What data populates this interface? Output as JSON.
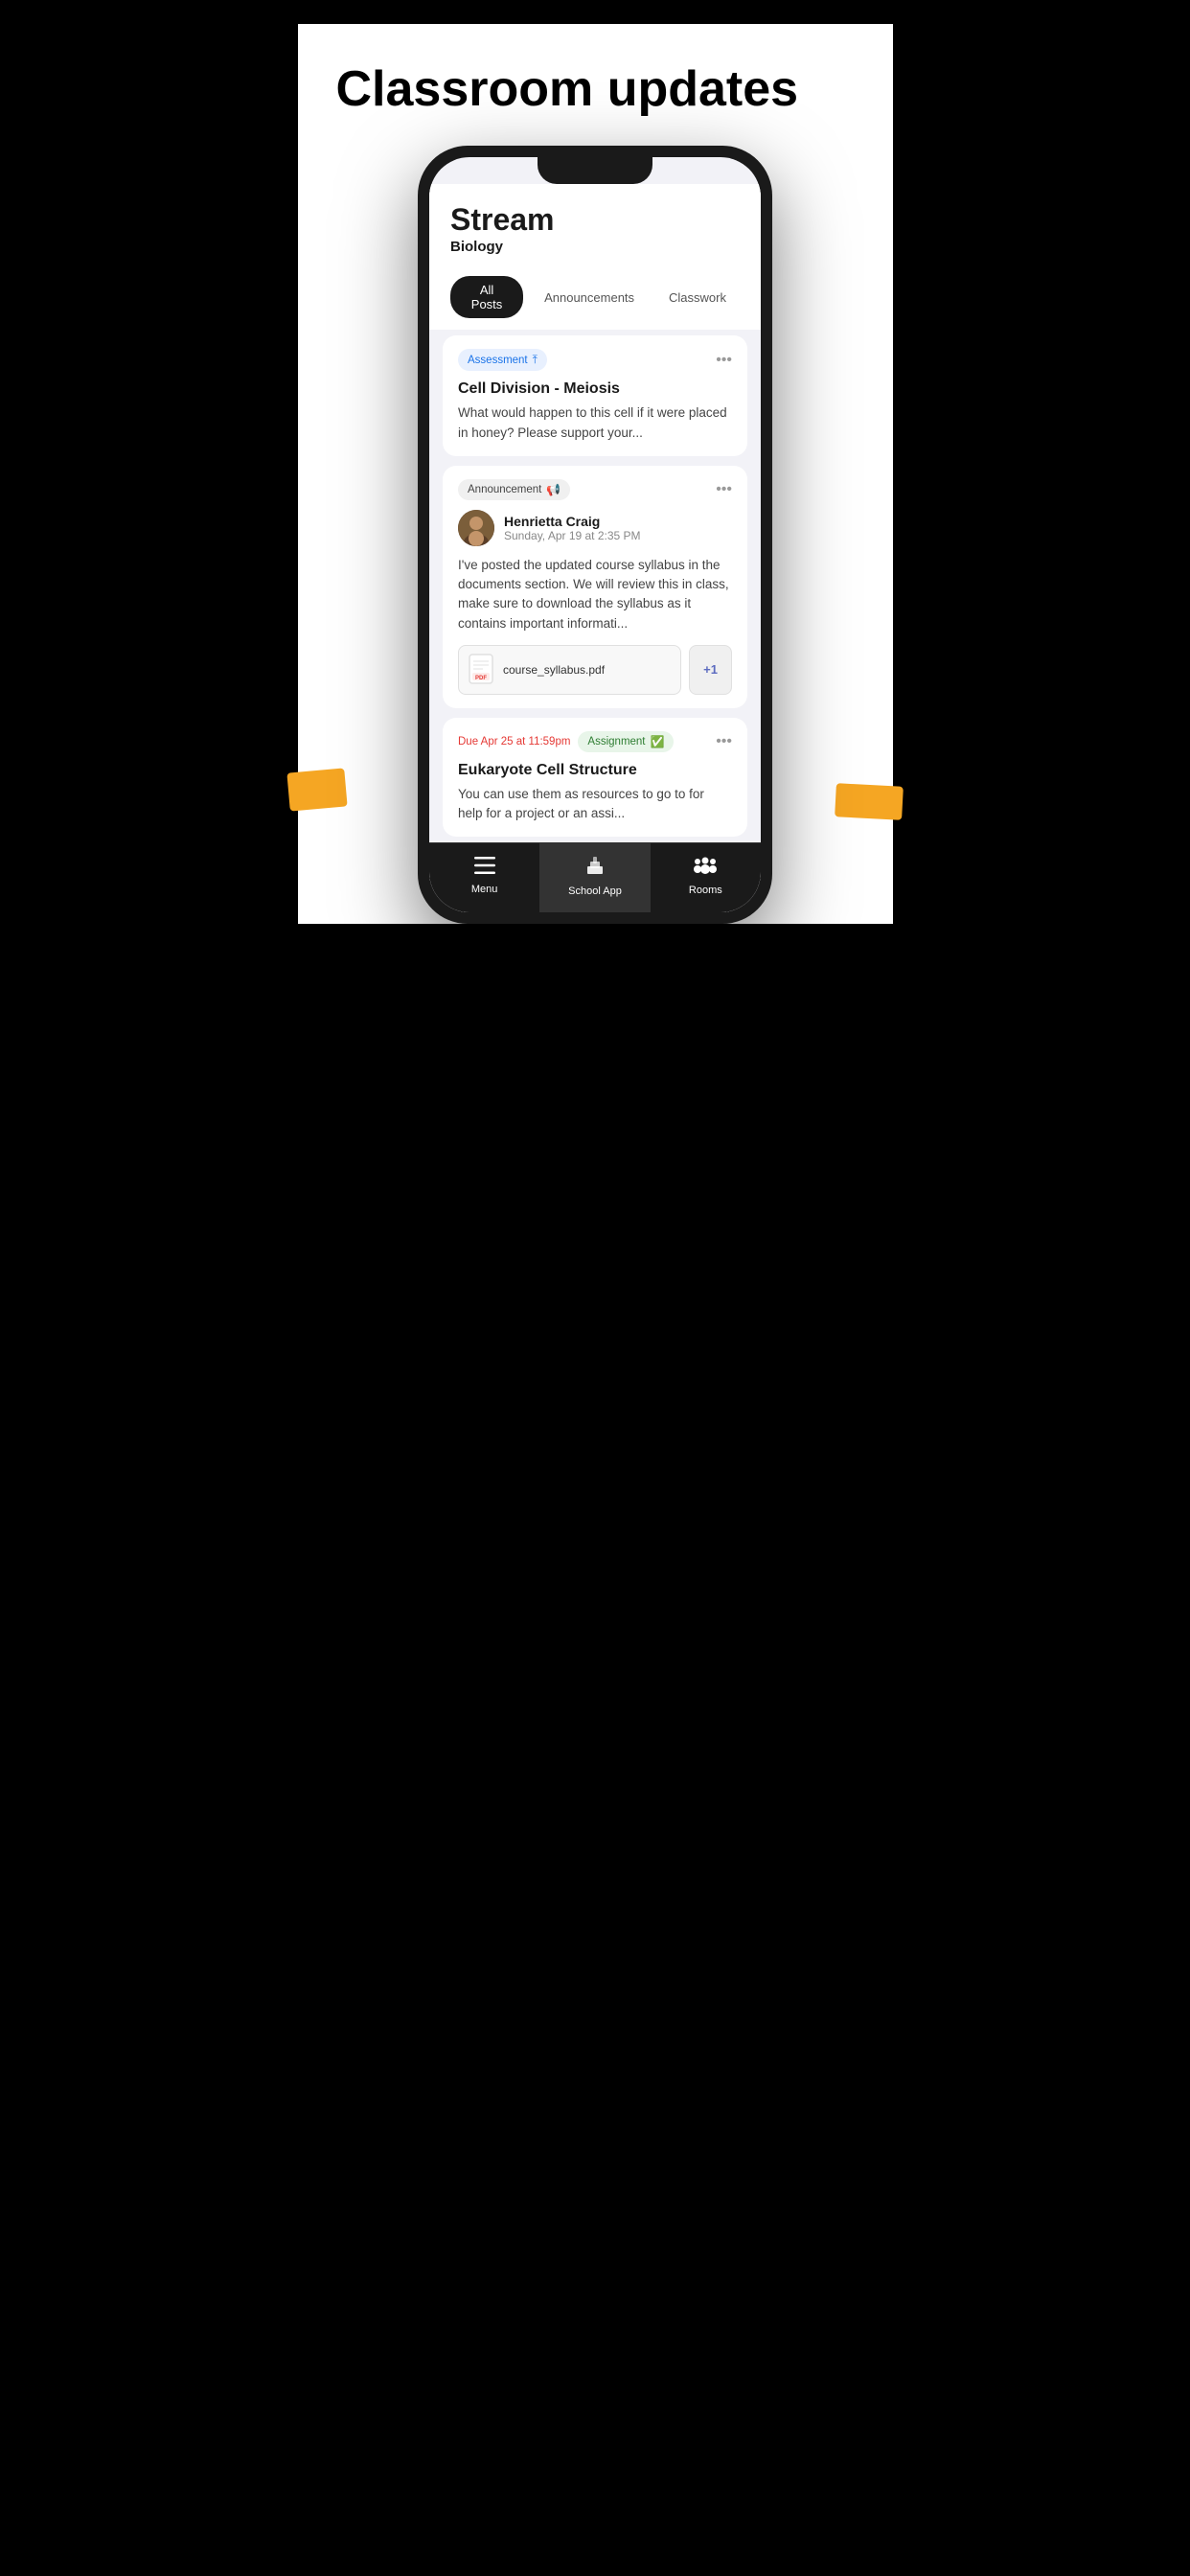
{
  "page": {
    "title": "Classroom updates",
    "background_top": "#fff",
    "background_bottom": "#000"
  },
  "stream": {
    "title": "Stream",
    "subtitle": "Biology",
    "tabs": [
      {
        "label": "All Posts",
        "active": true
      },
      {
        "label": "Announcements",
        "active": false
      },
      {
        "label": "Classwork",
        "active": false
      }
    ]
  },
  "cards": [
    {
      "type": "assessment",
      "badge_label": "Assessment",
      "title": "Cell Division - Meiosis",
      "body": "What would happen to this cell if it were placed in honey? Please support your...",
      "due_label": null,
      "author": null,
      "attachments": []
    },
    {
      "type": "announcement",
      "badge_label": "Announcement",
      "title": null,
      "body": "I've posted the updated course syllabus in the documents section. We will review this in class, make sure to download the syllabus as it contains important informati...",
      "due_label": null,
      "author": {
        "name": "Henrietta Craig",
        "date": "Sunday, Apr 19 at 2:35 PM"
      },
      "attachments": [
        {
          "name": "course_syllabus.pdf",
          "type": "pdf"
        }
      ],
      "extra_count": "+1"
    },
    {
      "type": "assignment",
      "badge_label": "Assignment",
      "title": "Eukaryote Cell Structure",
      "body": "You can use them as resources to go to for help for a project or an assi...",
      "due_label": "Due Apr 25 at 11:59pm",
      "author": null,
      "attachments": []
    }
  ],
  "bottom_nav": {
    "items": [
      {
        "label": "Menu",
        "icon": "menu-icon",
        "active": false
      },
      {
        "label": "School App",
        "icon": "school-icon",
        "active": true
      },
      {
        "label": "Rooms",
        "icon": "rooms-icon",
        "active": false
      }
    ]
  }
}
